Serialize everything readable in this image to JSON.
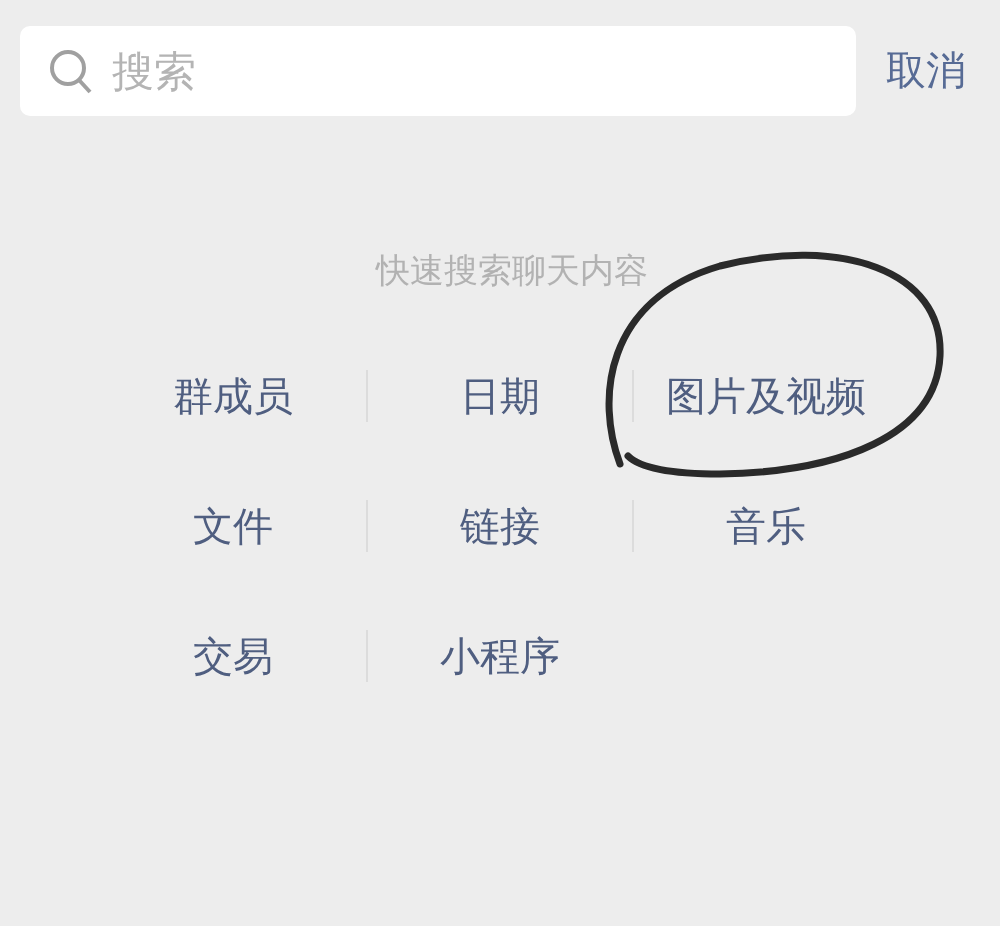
{
  "search": {
    "placeholder": "搜索"
  },
  "cancel": "取消",
  "heading": "快速搜索聊天内容",
  "categories": [
    [
      "群成员",
      "日期",
      "图片及视频"
    ],
    [
      "文件",
      "链接",
      "音乐"
    ],
    [
      "交易",
      "小程序"
    ]
  ]
}
